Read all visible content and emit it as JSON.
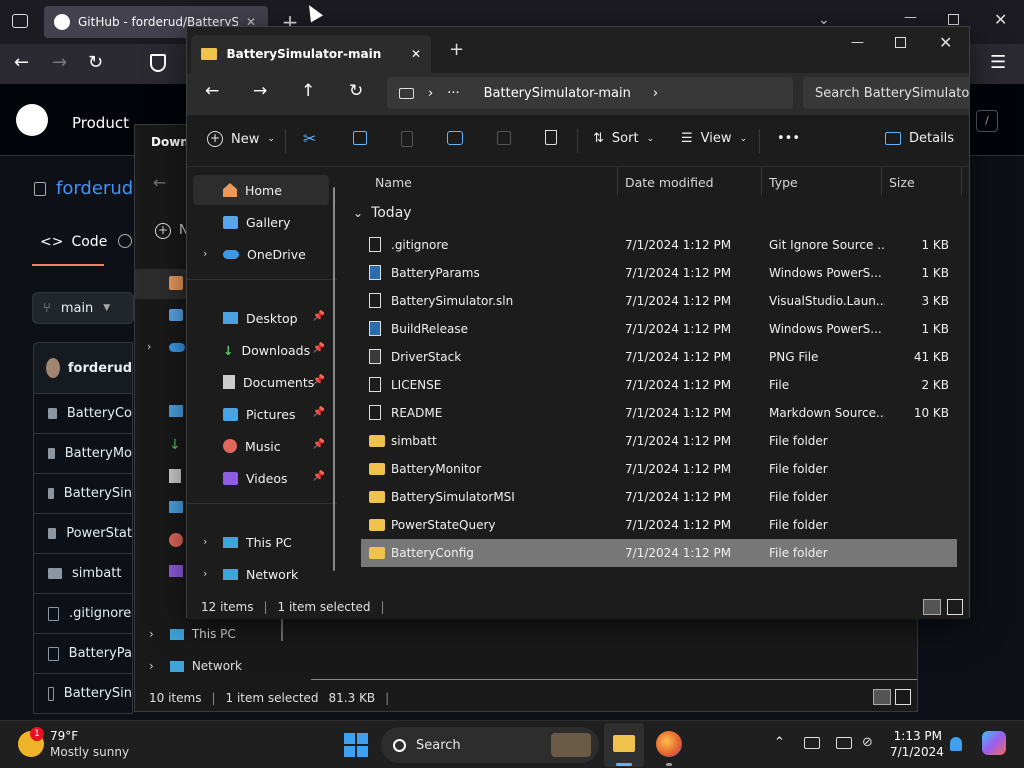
{
  "browser": {
    "tab_title": "GitHub - forderud/BatterySimulator",
    "new_tab_symbol": "+"
  },
  "github": {
    "nav_product": "Product",
    "repo_owner": "forderud",
    "code_tab": "Code",
    "branch": "main",
    "commit_author": "forderud",
    "files": [
      "BatteryCo",
      "BatteryMo",
      "BatterySin",
      "PowerStat",
      "simbatt",
      ".gitignore",
      "BatteryPa",
      "BatterySin"
    ]
  },
  "back_explorer": {
    "breadcrumb_fragment": "Downl",
    "new_fragment": "N",
    "nav": [
      "This PC",
      "Network"
    ],
    "status": {
      "count": "10 items",
      "selected": "1 item selected",
      "size": "81.3 KB"
    }
  },
  "explorer": {
    "tab_title": "BatterySimulator-main",
    "address": "BatterySimulator-main",
    "search_placeholder": "Search BatterySimulator-main",
    "commands": {
      "new": "New",
      "sort": "Sort",
      "view": "View",
      "more": "•••",
      "details": "Details"
    },
    "nav": [
      {
        "label": "Home",
        "icon": "home-icon",
        "selected": true
      },
      {
        "label": "Gallery",
        "icon": "gallery-icon"
      },
      {
        "label": "OneDrive",
        "icon": "onedrive-icon",
        "expandable": true
      },
      {
        "label": "Desktop",
        "icon": "desktop-icon",
        "pinned": true
      },
      {
        "label": "Downloads",
        "icon": "downloads-icon",
        "pinned": true
      },
      {
        "label": "Documents",
        "icon": "documents-icon",
        "pinned": true
      },
      {
        "label": "Pictures",
        "icon": "pictures-icon",
        "pinned": true
      },
      {
        "label": "Music",
        "icon": "music-icon",
        "pinned": true
      },
      {
        "label": "Videos",
        "icon": "videos-icon",
        "pinned": true
      },
      {
        "label": "This PC",
        "icon": "this-pc-icon",
        "expandable": true
      },
      {
        "label": "Network",
        "icon": "network-icon",
        "expandable": true
      }
    ],
    "columns": {
      "name": "Name",
      "date": "Date modified",
      "type": "Type",
      "size": "Size"
    },
    "group_label": "Today",
    "files": [
      {
        "name": ".gitignore",
        "date": "7/1/2024 1:12 PM",
        "type": "Git Ignore Source ...",
        "size": "1 KB",
        "kind": "file"
      },
      {
        "name": "BatteryParams",
        "date": "7/1/2024 1:12 PM",
        "type": "Windows PowerS...",
        "size": "1 KB",
        "kind": "script"
      },
      {
        "name": "BatterySimulator.sln",
        "date": "7/1/2024 1:12 PM",
        "type": "VisualStudio.Laun...",
        "size": "3 KB",
        "kind": "file"
      },
      {
        "name": "BuildRelease",
        "date": "7/1/2024 1:12 PM",
        "type": "Windows PowerS...",
        "size": "1 KB",
        "kind": "script"
      },
      {
        "name": "DriverStack",
        "date": "7/1/2024 1:12 PM",
        "type": "PNG File",
        "size": "41 KB",
        "kind": "image"
      },
      {
        "name": "LICENSE",
        "date": "7/1/2024 1:12 PM",
        "type": "File",
        "size": "2 KB",
        "kind": "file"
      },
      {
        "name": "README",
        "date": "7/1/2024 1:12 PM",
        "type": "Markdown Source...",
        "size": "10 KB",
        "kind": "file"
      },
      {
        "name": "simbatt",
        "date": "7/1/2024 1:12 PM",
        "type": "File folder",
        "size": "",
        "kind": "folder"
      },
      {
        "name": "BatteryMonitor",
        "date": "7/1/2024 1:12 PM",
        "type": "File folder",
        "size": "",
        "kind": "folder"
      },
      {
        "name": "BatterySimulatorMSI",
        "date": "7/1/2024 1:12 PM",
        "type": "File folder",
        "size": "",
        "kind": "folder"
      },
      {
        "name": "PowerStateQuery",
        "date": "7/1/2024 1:12 PM",
        "type": "File folder",
        "size": "",
        "kind": "folder"
      },
      {
        "name": "BatteryConfig",
        "date": "7/1/2024 1:12 PM",
        "type": "File folder",
        "size": "",
        "kind": "folder",
        "selected": true
      }
    ],
    "status": {
      "count": "12 items",
      "selected": "1 item selected"
    }
  },
  "taskbar": {
    "weather_temp": "79°F",
    "weather_desc": "Mostly sunny",
    "weather_badge": "1",
    "search_label": "Search",
    "time": "1:13 PM",
    "date": "7/1/2024"
  },
  "colors": {
    "folder": "#f0c14b",
    "accent": "#60b5ff",
    "selected_row": "#777777"
  }
}
